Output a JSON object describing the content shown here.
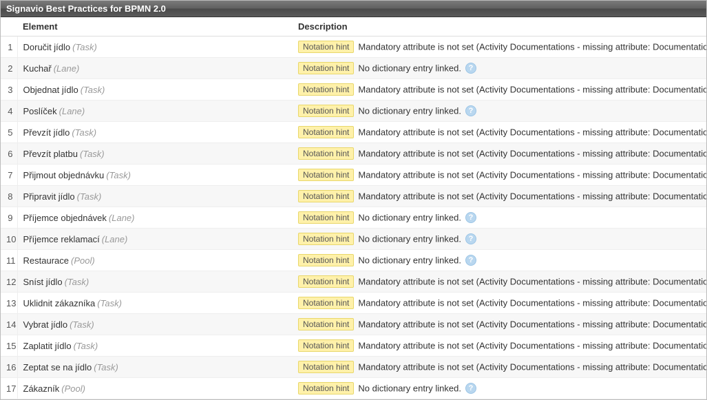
{
  "panel": {
    "title": "Signavio Best Practices for BPMN 2.0"
  },
  "columns": {
    "num": "",
    "element": "Element",
    "description": "Description"
  },
  "badge_label": "Notation hint",
  "help_glyph": "?",
  "messages": {
    "missing_doc": "Mandatory attribute is not set (Activity Documentations - missing attribute: Documentation)",
    "no_dict": "No dictionary entry linked."
  },
  "rows": [
    {
      "n": "1",
      "name": "Doručit jídlo",
      "type": "(Task)",
      "msg": "missing_doc"
    },
    {
      "n": "2",
      "name": "Kuchař",
      "type": "(Lane)",
      "msg": "no_dict"
    },
    {
      "n": "3",
      "name": "Objednat jídlo",
      "type": "(Task)",
      "msg": "missing_doc"
    },
    {
      "n": "4",
      "name": "Poslíček",
      "type": "(Lane)",
      "msg": "no_dict"
    },
    {
      "n": "5",
      "name": "Převzít jídlo",
      "type": "(Task)",
      "msg": "missing_doc"
    },
    {
      "n": "6",
      "name": "Převzít platbu",
      "type": "(Task)",
      "msg": "missing_doc"
    },
    {
      "n": "7",
      "name": "Přijmout objednávku",
      "type": "(Task)",
      "msg": "missing_doc"
    },
    {
      "n": "8",
      "name": "Připravit jídlo",
      "type": "(Task)",
      "msg": "missing_doc"
    },
    {
      "n": "9",
      "name": "Příjemce objednávek",
      "type": "(Lane)",
      "msg": "no_dict"
    },
    {
      "n": "10",
      "name": "Příjemce reklamací",
      "type": "(Lane)",
      "msg": "no_dict"
    },
    {
      "n": "11",
      "name": "Restaurace",
      "type": "(Pool)",
      "msg": "no_dict"
    },
    {
      "n": "12",
      "name": "Sníst jídlo",
      "type": "(Task)",
      "msg": "missing_doc"
    },
    {
      "n": "13",
      "name": "Uklidnit zákazníka",
      "type": "(Task)",
      "msg": "missing_doc"
    },
    {
      "n": "14",
      "name": "Vybrat jídlo",
      "type": "(Task)",
      "msg": "missing_doc"
    },
    {
      "n": "15",
      "name": "Zaplatit jídlo",
      "type": "(Task)",
      "msg": "missing_doc"
    },
    {
      "n": "16",
      "name": "Zeptat se na jídlo",
      "type": "(Task)",
      "msg": "missing_doc"
    },
    {
      "n": "17",
      "name": "Zákazník",
      "type": "(Pool)",
      "msg": "no_dict"
    }
  ]
}
